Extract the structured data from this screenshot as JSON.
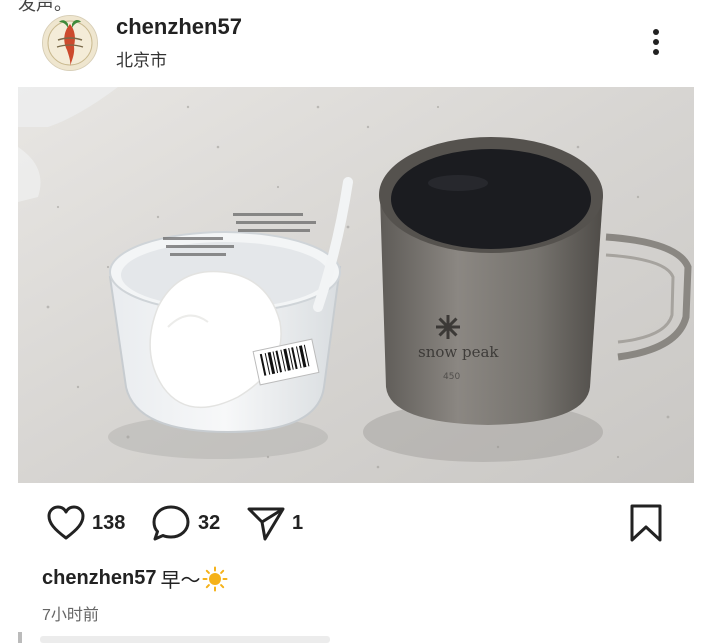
{
  "post": {
    "top_partial_text": "发声。",
    "username": "chenzhen57",
    "location": "北京市",
    "image_alt": "",
    "likes": "138",
    "comments": "32",
    "shares": "1",
    "caption_user": "chenzhen57",
    "caption_text": "早～",
    "caption_emoji": "☀️",
    "time_ago": "7小时前",
    "mug_brand": "snow peak",
    "mug_capacity": "450"
  },
  "icons": {
    "more": "more-vertical-icon",
    "like": "heart-icon",
    "comment": "comment-bubble-icon",
    "share": "send-icon",
    "bookmark": "bookmark-icon"
  },
  "colors": {
    "text": "#222222",
    "muted": "#666666",
    "sun": "#f5b21a"
  }
}
